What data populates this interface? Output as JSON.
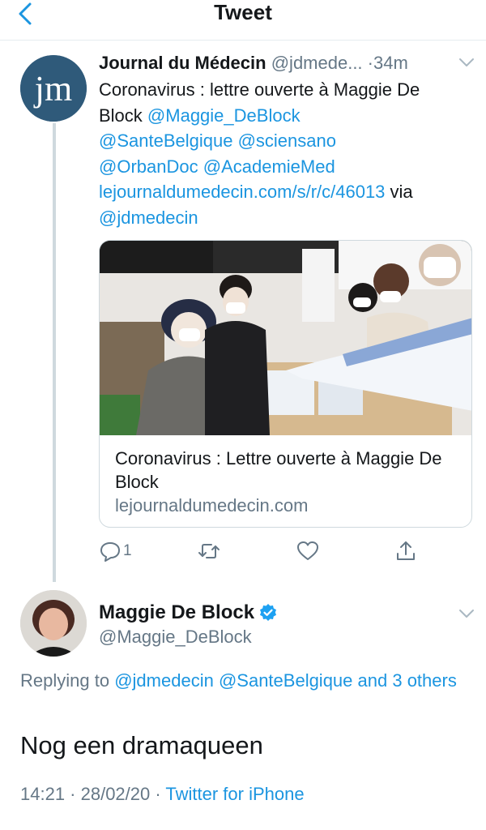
{
  "header": {
    "title": "Tweet"
  },
  "tweet1": {
    "name": "Journal du Médecin",
    "handle": "@jdmede...",
    "separator": "·",
    "time": "34m",
    "text_line1": "Coronavirus : lettre ouverte à Maggie De",
    "text_line2_plain": "Block",
    "mention1": "@Maggie_DeBlock",
    "mention2": "@SanteBelgique",
    "mention3": "@sciensano",
    "mention4": "@OrbanDoc",
    "mention5": "@AcademieMed",
    "url": "lejournaldumedecin.com/s/r/c/46013",
    "via": "via",
    "mention6": "@jdmedecin",
    "card": {
      "title": "Coronavirus : Lettre ouverte à Maggie De Block",
      "domain": "lejournaldumedecin.com"
    },
    "reply_count": "1"
  },
  "tweet2": {
    "name": "Maggie De Block",
    "handle": "@Maggie_DeBlock",
    "replying_prefix": "Replying to",
    "replying_mention1": "@jdmedecin",
    "replying_mention2": "@SanteBelgique",
    "replying_and_others": "and 3 others",
    "text": "Nog een dramaqueen",
    "timestamp": "14:21 · 28/02/20 ·",
    "source": "Twitter for iPhone"
  },
  "icons": {
    "back": "chevron-left-icon",
    "more": "chevron-down-icon",
    "reply": "reply-icon",
    "retweet": "retweet-icon",
    "like": "heart-icon",
    "share": "share-icon",
    "verified": "verified-badge-icon"
  },
  "colors": {
    "link": "#1b95e0",
    "secondary_text": "#657786",
    "primary_text": "#14171a",
    "border": "#cfd9de",
    "jm_avatar": "#2f5a7a"
  }
}
